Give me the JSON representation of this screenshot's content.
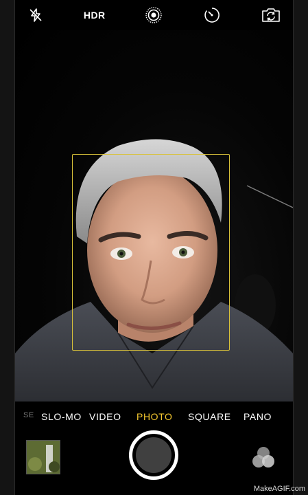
{
  "top_bar": {
    "flash_icon": "flash-off-icon",
    "hdr_label": "HDR",
    "live_icon": "live-photo-icon",
    "timer_icon": "timer-icon",
    "switch_icon": "camera-switch-icon"
  },
  "viewfinder": {
    "face_box_color": "#d9c23a"
  },
  "modes": {
    "items": [
      "SE",
      "SLO-MO",
      "VIDEO",
      "PHOTO",
      "SQUARE",
      "PANO"
    ],
    "selected": "PHOTO",
    "accent": "#f5c830"
  },
  "bottom": {
    "thumbnail_icon": "last-photo-thumbnail",
    "shutter_icon": "shutter-button",
    "filters_icon": "filters-icon"
  },
  "watermark": "MakeAGIF.com"
}
